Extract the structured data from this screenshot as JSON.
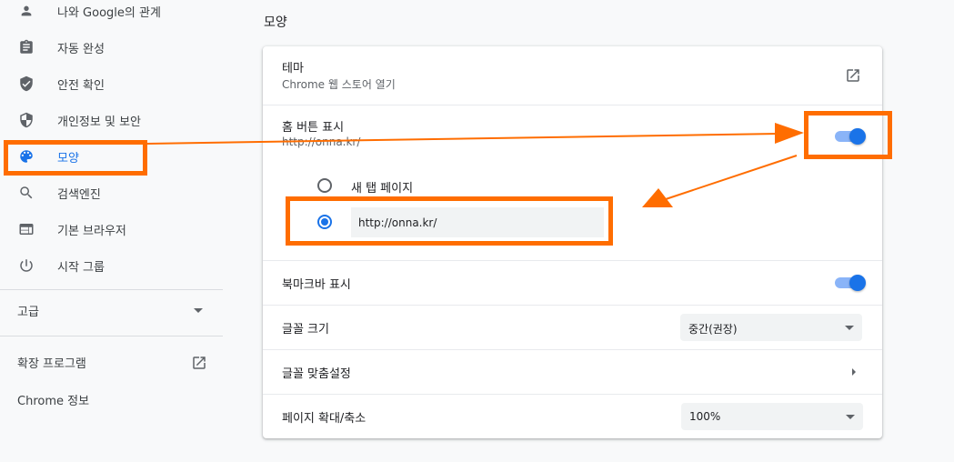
{
  "sidebar": {
    "items": [
      {
        "label": "나와 Google의 관계",
        "icon": "person-icon"
      },
      {
        "label": "자동 완성",
        "icon": "assignment-icon"
      },
      {
        "label": "안전 확인",
        "icon": "shield-check-icon"
      },
      {
        "label": "개인정보 및 보안",
        "icon": "security-shield-icon"
      },
      {
        "label": "모양",
        "icon": "palette-icon",
        "active": true
      },
      {
        "label": "검색엔진",
        "icon": "search-icon"
      },
      {
        "label": "기본 브라우저",
        "icon": "browser-window-icon"
      },
      {
        "label": "시작 그룹",
        "icon": "power-icon"
      }
    ],
    "advanced_label": "고급",
    "extensions_label": "확장 프로그램",
    "about_label": "Chrome 정보"
  },
  "main": {
    "section_title": "모양",
    "theme": {
      "title": "테마",
      "subtitle": "Chrome 웹 스토어 열기"
    },
    "home_button": {
      "title": "홈 버튼 표시",
      "subtitle": "http://onna.kr/",
      "enabled": true,
      "options": {
        "new_tab_label": "새 탭 페이지",
        "custom_url_value": "http://onna.kr/"
      }
    },
    "bookmarks_bar": {
      "title": "북마크바 표시",
      "enabled": true
    },
    "font_size": {
      "title": "글꼴 크기",
      "value": "중간(권장)"
    },
    "customize_fonts": {
      "title": "글꼴 맞춤설정"
    },
    "page_zoom": {
      "title": "페이지 확대/축소",
      "value": "100%"
    }
  },
  "colors": {
    "accent": "#1a73e8",
    "annotation": "#ff6d00",
    "toggle_track": "#8ab4f8"
  }
}
